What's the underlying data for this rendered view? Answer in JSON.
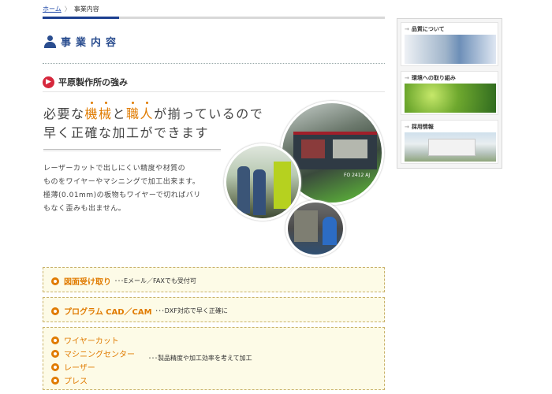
{
  "breadcrumb": {
    "home": "ホーム",
    "separator": "〉",
    "current": "事業内容"
  },
  "page_title": "事業内容",
  "section": {
    "title": "平原製作所の強み"
  },
  "catch": {
    "line1_pre": "必要な",
    "line1_em1": "機械",
    "line1_mid": "と",
    "line1_em2": "職人",
    "line1_post": "が揃っているので",
    "line2": "早く正確な加工ができます"
  },
  "description": [
    "レーザーカットで出しにくい精度や材質の",
    "ものをワイヤーやマシニングで加工出来ます。",
    "極薄(0.01mm)の板物もワイヤーで切ればバリ",
    "もなく歪みも出ません。"
  ],
  "photos": {
    "machine_label": "FO 2412 AJ"
  },
  "services": {
    "drawing": {
      "label": "図面受け取り",
      "note": "･･･Eメール／FAXでも受付可"
    },
    "cad": {
      "label": "プログラム CAD／CAM",
      "note": "･･･DXF対応で早く正確に"
    },
    "processes": [
      "ワイヤーカット",
      "マシニングセンター",
      "レーザー",
      "プレス"
    ],
    "processes_note": "･･･製品精度や加工効率を考えて加工"
  },
  "sidebar": {
    "items": [
      {
        "label": "品質について"
      },
      {
        "label": "環境への取り組み"
      },
      {
        "label": "採用情報"
      }
    ]
  },
  "colors": {
    "accent": "#e07b00",
    "brand_blue": "#2a4d8f",
    "arrow_red": "#d6283d",
    "box_bg": "#fdfbe7"
  }
}
